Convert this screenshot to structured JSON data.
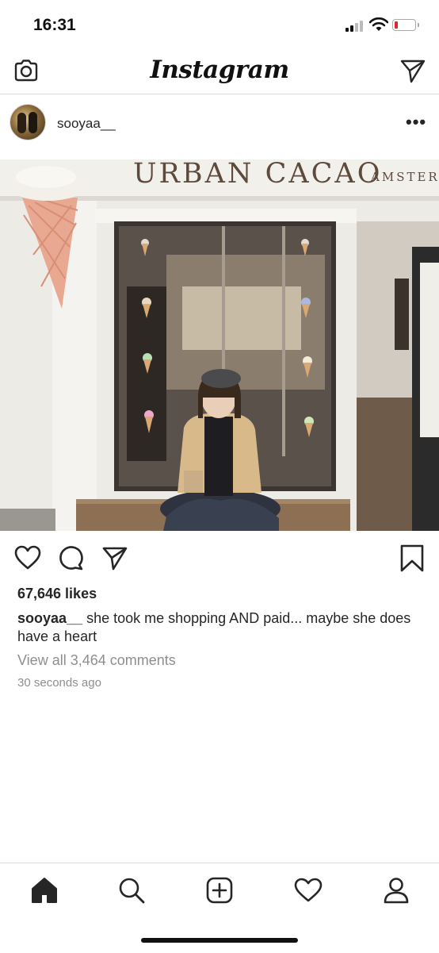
{
  "status_bar": {
    "time": "16:31"
  },
  "header": {
    "title": "Instagram"
  },
  "post": {
    "username": "sooyaa__",
    "photo": {
      "sign_main": "URBAN CACAO",
      "sign_side": "AMSTER"
    },
    "likes": "67,646 likes",
    "caption_user": "sooyaa__",
    "caption_text": " she took me shopping AND paid... maybe she does have a heart",
    "view_comments": "View all 3,464 comments",
    "time_ago": "30 seconds ago"
  },
  "icons": {
    "header": [
      "camera-icon",
      "direct-message-icon"
    ],
    "post_actions": [
      "heart-icon",
      "comment-icon",
      "share-icon",
      "bookmark-icon"
    ],
    "tab_bar": [
      "home-icon",
      "search-icon",
      "add-post-icon",
      "activity-heart-icon",
      "profile-icon"
    ]
  },
  "colors": {
    "muted_text": "#8e8e8e",
    "battery_low": "#e0262b",
    "divider": "#dbdbdb"
  }
}
